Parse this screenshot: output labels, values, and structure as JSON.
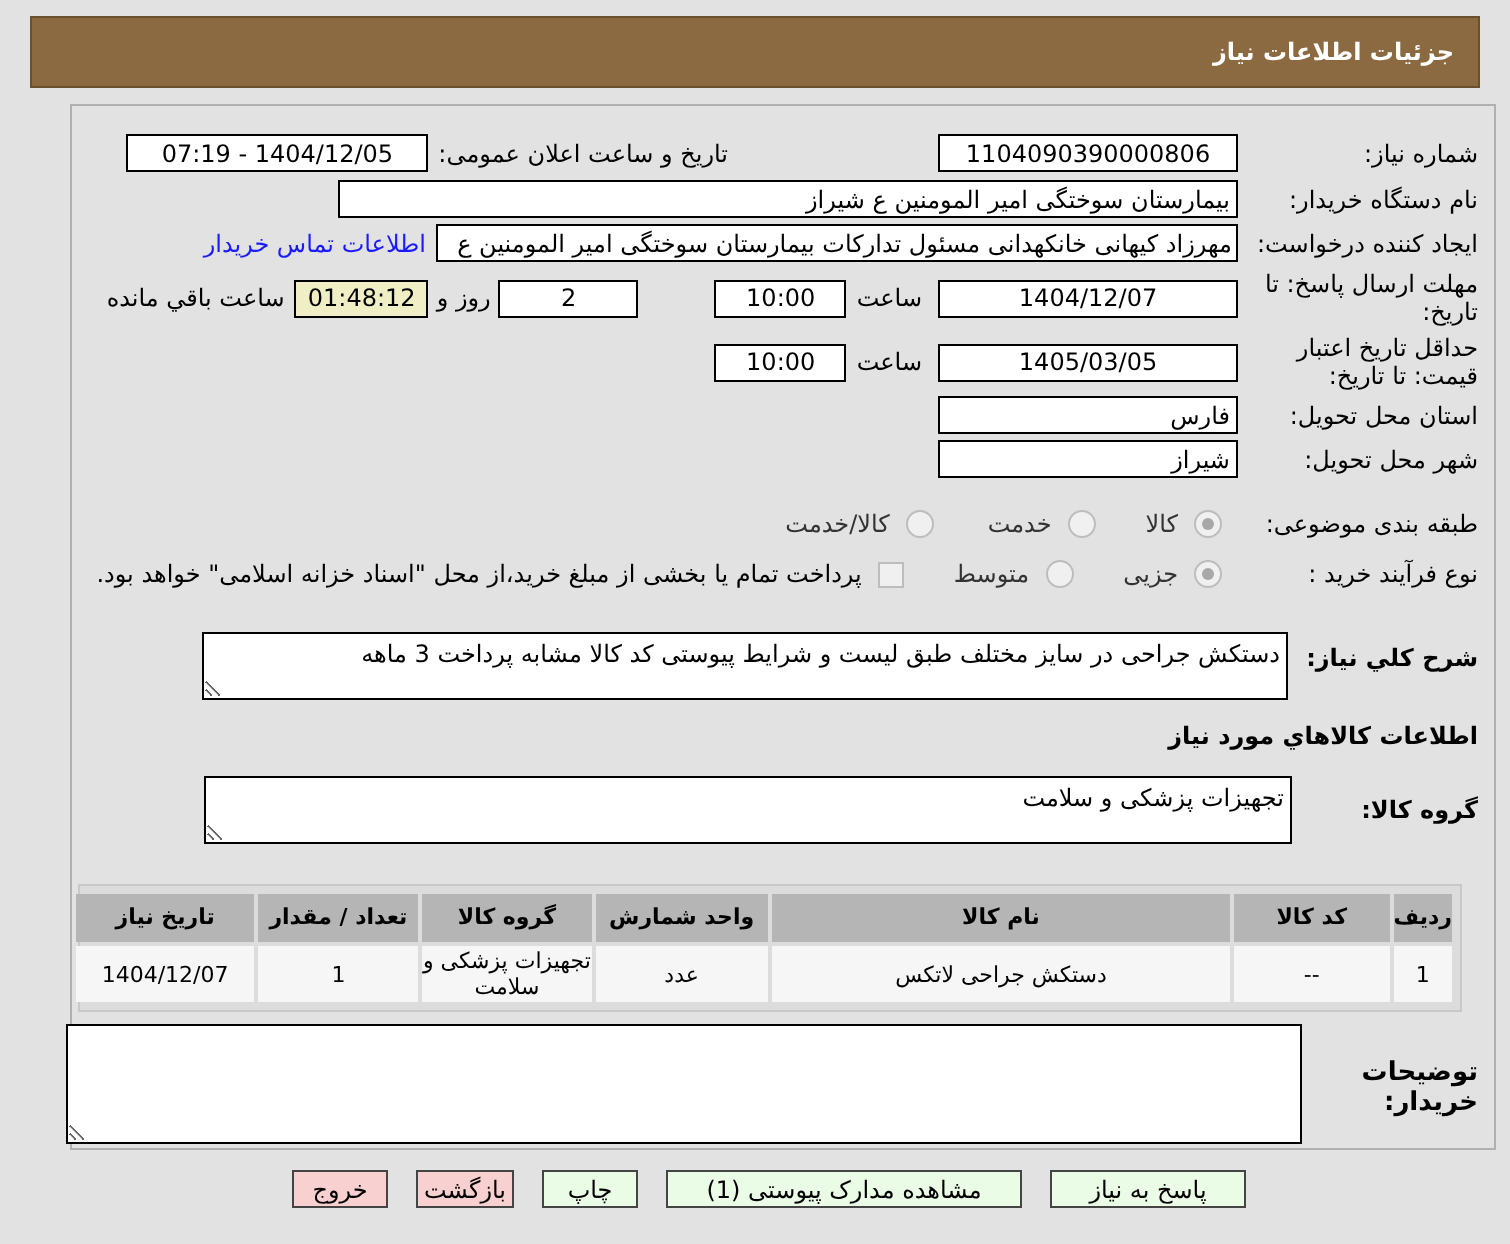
{
  "header": {
    "title": "جزئیات اطلاعات نیاز"
  },
  "need_number": {
    "label": "شماره نیاز:",
    "value": "1104090390000806"
  },
  "announce_datetime": {
    "label": "تاریخ و ساعت اعلان عمومی:",
    "value": "1404/12/05 - 07:19"
  },
  "buyer_org": {
    "label": "نام دستگاه خریدار:",
    "value": "بیمارستان سوختگی امیر المومنین  ع  شیراز"
  },
  "requester": {
    "label": "ایجاد کننده درخواست:",
    "value": "مهرزاد کیهانی خانکهدانی مسئول تداركات بیمارستان سوختگی امیر المومنین  ع",
    "link": "اطلاعات تماس خریدار"
  },
  "reply_deadline": {
    "label": "مهلت ارسال پاسخ: تا تاریخ:",
    "date": "1404/12/07",
    "time_label": "ساعت",
    "time": "10:00",
    "days": "2",
    "days_label": "روز و",
    "remaining": "01:48:12",
    "remaining_label": "ساعت باقي مانده"
  },
  "price_validity": {
    "label": "حداقل تاریخ اعتبار قیمت: تا تاریخ:",
    "date": "1405/03/05",
    "time_label": "ساعت",
    "time": "10:00"
  },
  "province": {
    "label": "استان محل تحویل:",
    "value": "فارس"
  },
  "city": {
    "label": "شهر محل تحویل:",
    "value": "شیراز"
  },
  "subject_category": {
    "label": "طبقه بندی موضوعی:",
    "options": [
      {
        "label": "کالا",
        "selected": true
      },
      {
        "label": "خدمت",
        "selected": false
      },
      {
        "label": "کالا/خدمت",
        "selected": false
      }
    ]
  },
  "purchase_process": {
    "label": "نوع فرآیند خرید :",
    "options": [
      {
        "label": "جزیی",
        "selected": true
      },
      {
        "label": "متوسط",
        "selected": false
      }
    ],
    "treasury": {
      "checked": false,
      "text": "پرداخت تمام یا بخشی از مبلغ خرید،از محل \"اسناد خزانه اسلامی\" خواهد بود."
    }
  },
  "description": {
    "label": "شرح کلي نیاز:",
    "value": "دستکش جراحی در سایز مختلف طبق لیست و شرایط پیوستی کد کالا مشابه پرداخت 3 ماهه"
  },
  "goods_section_title": "اطلاعات کالاهاي مورد نیاز",
  "goods_group": {
    "label": "گروه کالا:",
    "value": "تجهیزات پزشکی و سلامت"
  },
  "table": {
    "columns": [
      "ردیف",
      "کد کالا",
      "نام کالا",
      "واحد شمارش",
      "گروه کالا",
      "تعداد / مقدار",
      "تاریخ نیاز"
    ],
    "rows": [
      [
        "1",
        "--",
        "دستکش جراحی لاتکس",
        "عدد",
        "تجهیزات پزشکی و سلامت",
        "1",
        "1404/12/07"
      ]
    ]
  },
  "buyer_notes": {
    "label": "توضیحات خریدار:"
  },
  "buttons": [
    {
      "label": "پاسخ به نیاز",
      "color": "#eafbe6"
    },
    {
      "label": "مشاهده مدارک پیوستی (1)",
      "color": "#eafbe6"
    },
    {
      "label": "چاپ",
      "color": "#eafbe6"
    },
    {
      "label": "بازگشت",
      "color": "#f8d0d0"
    },
    {
      "label": "خروج",
      "color": "#f8d0d0"
    }
  ]
}
